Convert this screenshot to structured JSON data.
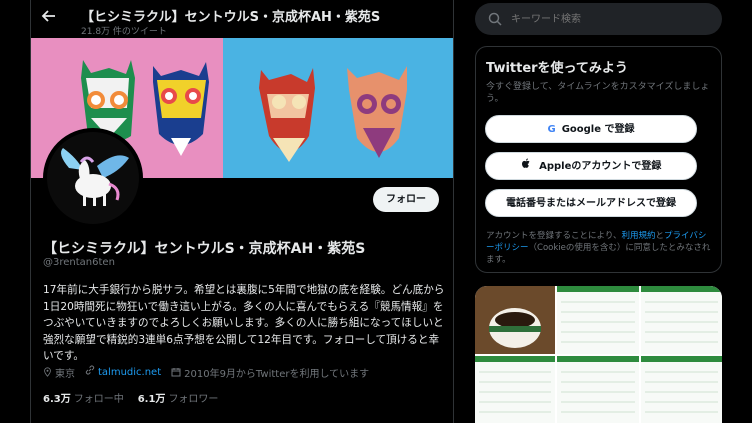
{
  "header": {
    "title": "【ヒシミラクル】セントウルS・京成杯AH・紫苑S",
    "subtitle": "21.8万 件のツイート"
  },
  "profile": {
    "follow_label": "フォロー",
    "name": "【ヒシミラクル】セントウルS・京成杯AH・紫苑S",
    "handle": "@3rentan6ten",
    "bio": "17年前に大手銀行から脱サラ。希望とは裏腹に5年間で地獄の底を経験。どん底から1日20時間死に物狂いで働き這い上がる。多くの人に喜んでもらえる『競馬情報』をつぶやいていきますのでよろしくお願いします。多くの人に勝ち組になってほしいと強烈な願望で精鋭的3連単6点予想を公開して12年目です。フォローして頂けると幸いです。",
    "location": "東京",
    "website": "talmudic.net",
    "joined": "2010年9月からTwitterを利用しています",
    "following_count": "6.3万",
    "following_label": "フォロー中",
    "followers_count": "6.1万",
    "followers_label": "フォロワー"
  },
  "search": {
    "placeholder": "キーワード検索"
  },
  "signup": {
    "title": "Twitterを使ってみよう",
    "desc": "今すぐ登録して、タイムラインをカスタマイズしましょう。",
    "google_label": "Google で登録",
    "apple_label": "Appleのアカウントで登録",
    "phone_label": "電話番号またはメールアドレスで登録",
    "legal_prefix": "アカウントを登録することにより、",
    "legal_terms": "利用規約",
    "legal_and": "と",
    "legal_privacy": "プライバシーポリシー",
    "legal_cookie": "（Cookieの使用",
    "legal_suffix": "を含む）に同意したとみなされます。"
  },
  "colors": {
    "accent": "#1d9bf0",
    "banner_pink": "#e88fc0",
    "banner_blue": "#4ab3e3"
  }
}
